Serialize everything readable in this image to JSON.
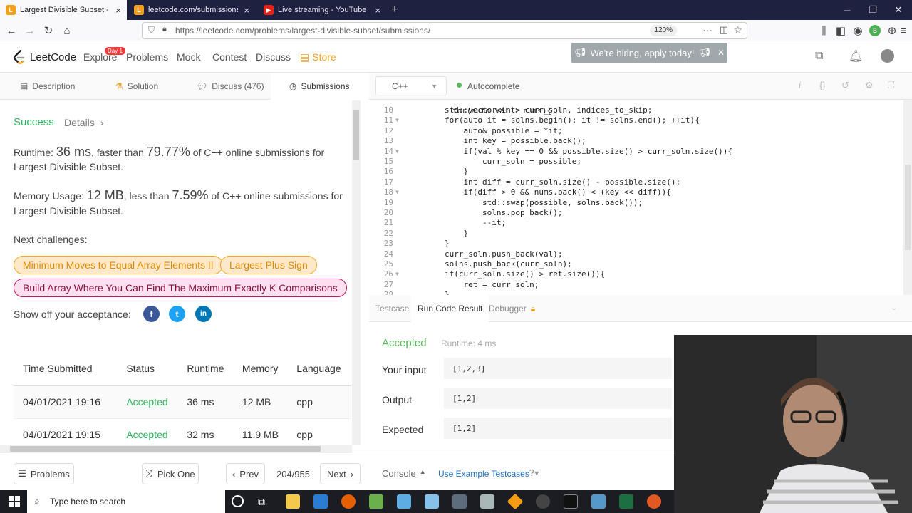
{
  "browser": {
    "tabs": [
      {
        "label": "Largest Divisible Subset - LeetC",
        "active": true
      },
      {
        "label": "leetcode.com/submissions/de",
        "active": false
      },
      {
        "label": "Live streaming - YouTube Stud",
        "active": false
      }
    ],
    "new_tab": "+",
    "url": "https://leetcode.com/problems/largest-divisible-subset/submissions/",
    "zoom": "120%",
    "avatar_initial": "B"
  },
  "header": {
    "logo_text": "LeetCode",
    "nav": [
      "Explore",
      "Problems",
      "Mock",
      "Contest",
      "Discuss",
      "Store"
    ],
    "explore_badge": "Day 1",
    "hiring_banner": "We're hiring, apply today!"
  },
  "left_tabs": [
    "Description",
    "Solution",
    "Discuss (476)",
    "Submissions"
  ],
  "submission": {
    "status": "Success",
    "details_link": "Details",
    "runtime_label": "Runtime:",
    "runtime_value": "36 ms",
    "runtime_mid": ", faster than",
    "runtime_pct": "79.77%",
    "runtime_tail": "of C++ online submissions for Largest Divisible Subset.",
    "memory_label": "Memory Usage:",
    "memory_value": "12 MB",
    "memory_mid": ", less than",
    "memory_pct": "7.59%",
    "memory_tail": "of C++ online submissions for Largest Divisible Subset.",
    "next_challenges_label": "Next challenges:",
    "challenges": [
      "Minimum Moves to Equal Array Elements II",
      "Largest Plus Sign",
      "Build Array Where You Can Find The Maximum Exactly K Comparisons"
    ],
    "share_label": "Show off your acceptance:",
    "social": [
      "f",
      "t",
      "in"
    ]
  },
  "table": {
    "headers": [
      "Time Submitted",
      "Status",
      "Runtime",
      "Memory",
      "Language"
    ],
    "rows": [
      [
        "04/01/2021 19:16",
        "Accepted",
        "36 ms",
        "12 MB",
        "cpp"
      ],
      [
        "04/01/2021 19:15",
        "Accepted",
        "32 ms",
        "11.9 MB",
        "cpp"
      ]
    ]
  },
  "editor": {
    "language": "C++",
    "autocomplete": "Autocomplete",
    "top_partial": "for(auto val : nums){",
    "lines": [
      {
        "n": "10",
        "code": "        std::vector<int> curr_soln, indices_to_skip;"
      },
      {
        "n": "11",
        "code": "        for(auto it = solns.begin(); it != solns.end(); ++it){",
        "fold": true
      },
      {
        "n": "12",
        "code": "            auto& possible = *it;"
      },
      {
        "n": "13",
        "code": "            int key = possible.back();"
      },
      {
        "n": "14",
        "code": "            if(val % key == 0 && possible.size() > curr_soln.size()){",
        "fold": true
      },
      {
        "n": "15",
        "code": "                curr_soln = possible;"
      },
      {
        "n": "16",
        "code": "            }"
      },
      {
        "n": "17",
        "code": "            int diff = curr_soln.size() - possible.size();"
      },
      {
        "n": "18",
        "code": "            if(diff > 0 && nums.back() < (key << diff)){",
        "fold": true
      },
      {
        "n": "19",
        "code": "                std::swap(possible, solns.back());"
      },
      {
        "n": "20",
        "code": "                solns.pop_back();"
      },
      {
        "n": "21",
        "code": "                --it;"
      },
      {
        "n": "22",
        "code": "            }"
      },
      {
        "n": "23",
        "code": "        }"
      },
      {
        "n": "24",
        "code": "        curr_soln.push_back(val);"
      },
      {
        "n": "25",
        "code": "        solns.push_back(curr_soln);"
      },
      {
        "n": "26",
        "code": "        if(curr_soln.size() > ret.size()){",
        "fold": true
      },
      {
        "n": "27",
        "code": "            ret = curr_soln;"
      },
      {
        "n": "28",
        "code": "        }"
      }
    ]
  },
  "result": {
    "tabs": [
      "Testcase",
      "Run Code Result",
      "Debugger"
    ],
    "status": "Accepted",
    "runtime": "Runtime: 4 ms",
    "your_input_label": "Your input",
    "your_input": "[1,2,3]",
    "output_label": "Output",
    "output": "[1,2]",
    "expected_label": "Expected",
    "expected": "[1,2]"
  },
  "bottom": {
    "problems": "Problems",
    "pick_one": "Pick One",
    "prev": "Prev",
    "page": "204/955",
    "next": "Next",
    "console": "Console",
    "use_example": "Use Example Testcases"
  },
  "taskbar": {
    "search_placeholder": "Type here to search"
  },
  "colors": {
    "accent_green": "#5cb85c",
    "success_teal": "#2db55d",
    "orange": "#f5a623",
    "store": "#f0a021"
  }
}
